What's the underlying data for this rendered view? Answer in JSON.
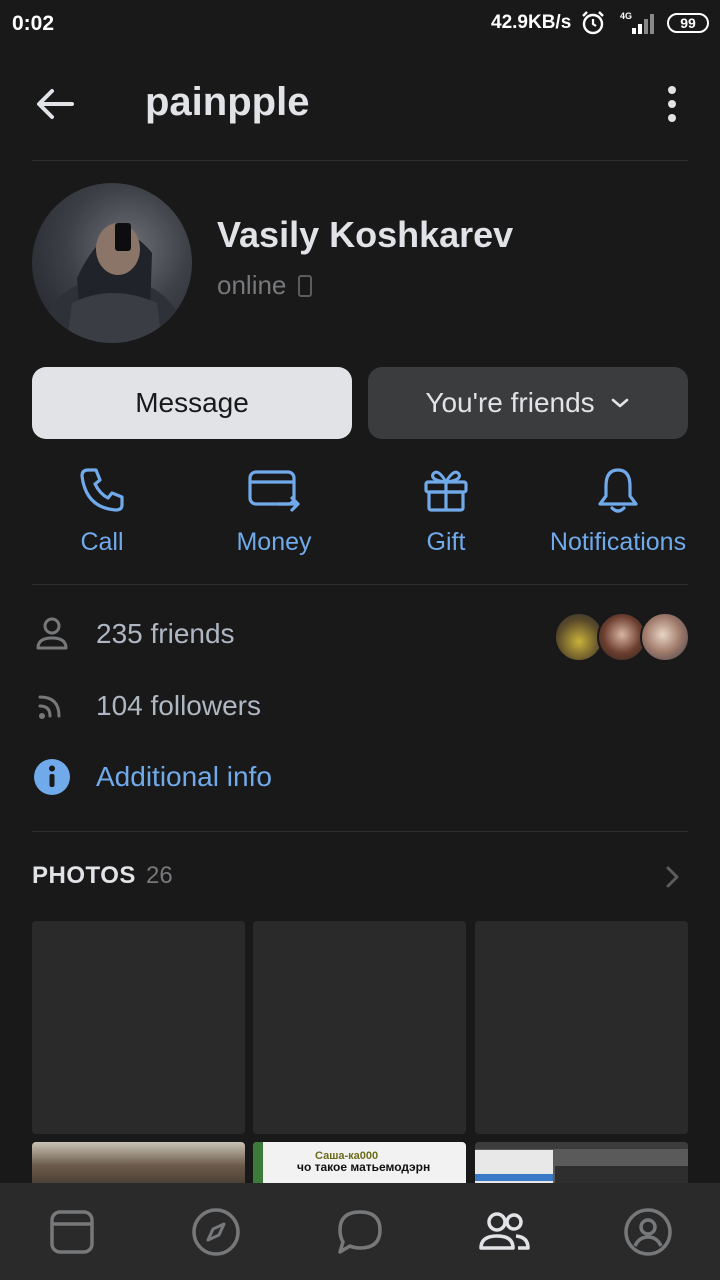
{
  "status_bar": {
    "time": "0:02",
    "speed": "42.9KB/s",
    "network": "4G",
    "battery": "99"
  },
  "header": {
    "title": "painpple"
  },
  "profile": {
    "name": "Vasily Koshkarev",
    "status": "online"
  },
  "buttons": {
    "message": "Message",
    "friends": "You're friends"
  },
  "actions": [
    {
      "label": "Call",
      "icon": "phone-icon"
    },
    {
      "label": "Money",
      "icon": "money-icon"
    },
    {
      "label": "Gift",
      "icon": "gift-icon"
    },
    {
      "label": "Notifications",
      "icon": "bell-icon"
    }
  ],
  "info": {
    "friends": "235 friends",
    "followers": "104 followers",
    "additional": "Additional info"
  },
  "photos": {
    "heading": "PHOTOS",
    "count": "26",
    "thumb_text": "чо такое матьемодэрн",
    "thumb_text_top": "Саша-ка000"
  },
  "nav": [
    {
      "icon": "news-icon"
    },
    {
      "icon": "explore-icon"
    },
    {
      "icon": "messages-icon"
    },
    {
      "icon": "friends-icon",
      "active": true
    },
    {
      "icon": "profile-icon"
    }
  ],
  "colors": {
    "background": "#19191a",
    "accent": "#71aaeb",
    "text": "#e1e3e6",
    "muted": "#76787a"
  }
}
